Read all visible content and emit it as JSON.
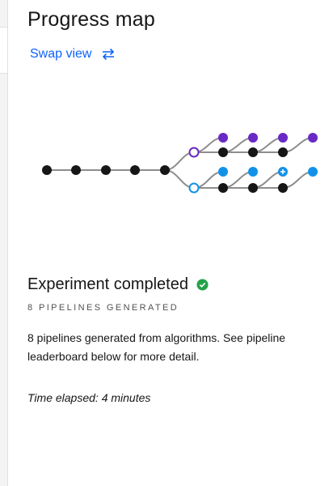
{
  "panel": {
    "title": "Progress map",
    "swap_label": "Swap view",
    "swap_icon": "swap-arrows-icon"
  },
  "status": {
    "title": "Experiment completed",
    "icon": "check-circle-icon",
    "icon_color": "#24a148",
    "subcaption": "8 PIPELINES GENERATED",
    "description": "8 pipelines generated from algorithms. See pipeline leaderboard below for more detail.",
    "elapsed": "Time elapsed: 4 minutes"
  },
  "colors": {
    "link": "#0f62fe",
    "node_black": "#161616",
    "node_purple": "#6929c4",
    "node_blue": "#1192e8",
    "edge_gray": "#8d8d8d"
  }
}
